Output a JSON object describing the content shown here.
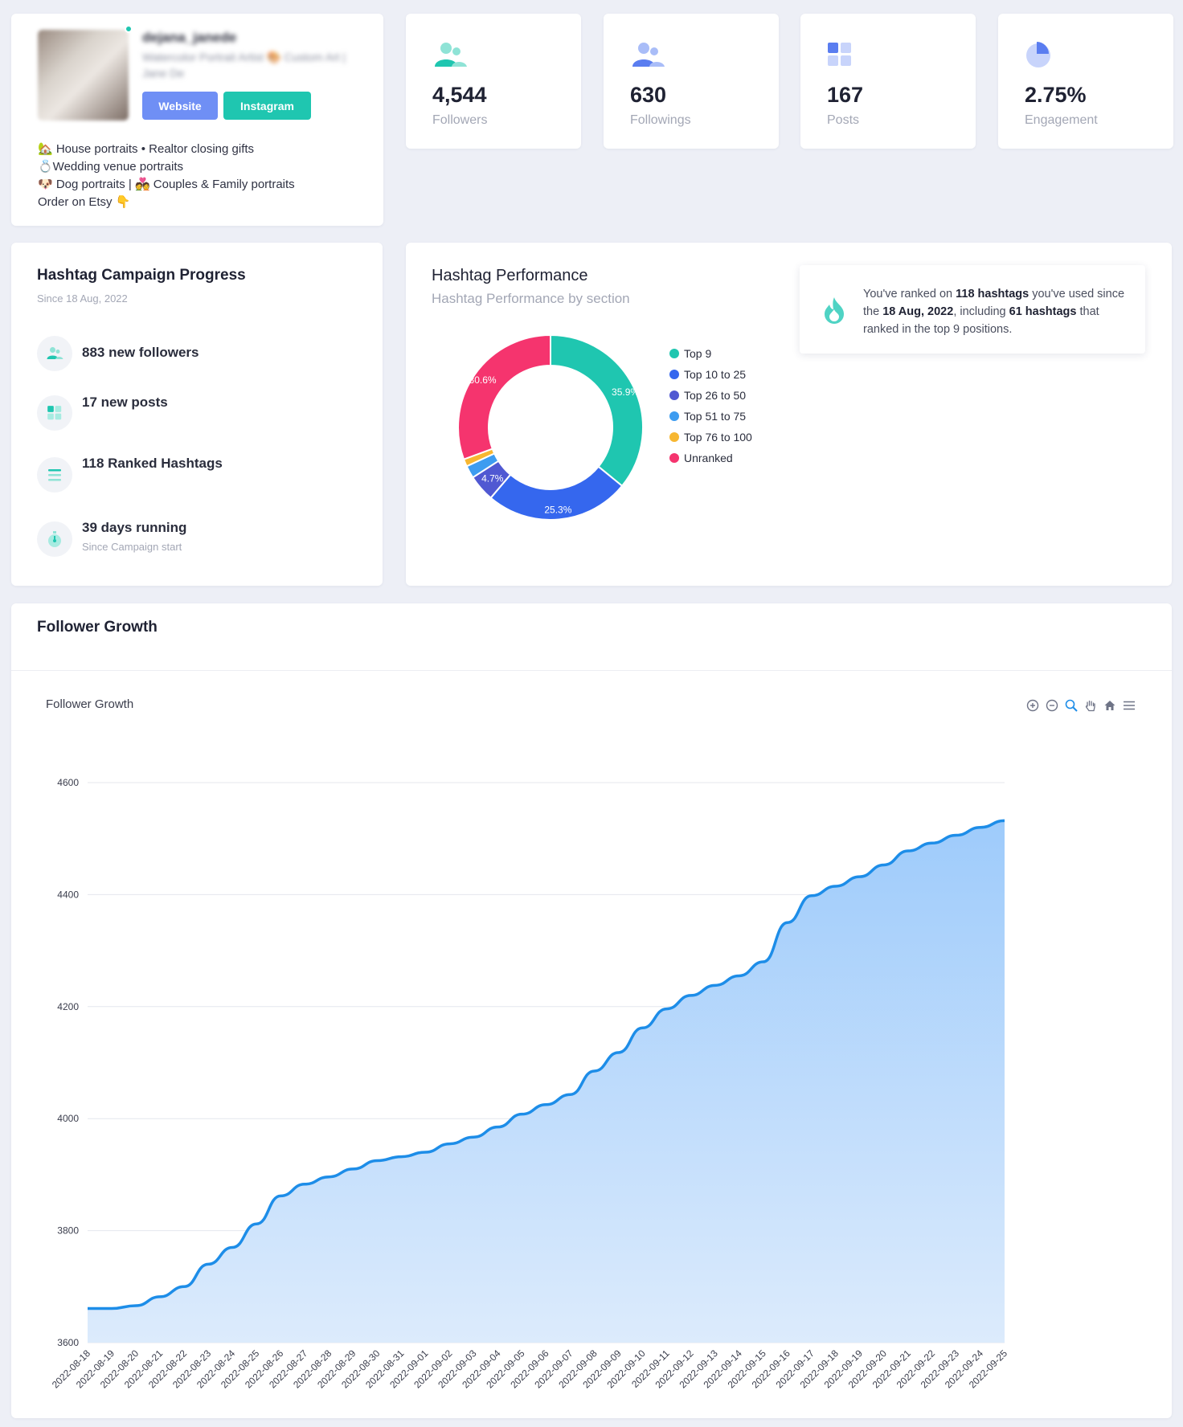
{
  "profile": {
    "username": "dejana_janede",
    "bio_blurred": "Watercolor Portrait Artist 🎨 Custom Art | Jane De",
    "website_label": "Website",
    "instagram_label": "Instagram",
    "bio_line1": "🏡 House portraits • Realtor closing gifts",
    "bio_line2": "💍Wedding venue portraits",
    "bio_line3": "🐶 Dog portraits | 💑 Couples & Family portraits",
    "bio_line4": "Order on Etsy 👇"
  },
  "stats": {
    "followers": {
      "value": "4,544",
      "label": "Followers",
      "icon": "users-icon"
    },
    "followings": {
      "value": "630",
      "label": "Followings",
      "icon": "users-icon"
    },
    "posts": {
      "value": "167",
      "label": "Posts",
      "icon": "grid-icon"
    },
    "engagement": {
      "value": "2.75%",
      "label": "Engagement",
      "icon": "pie-icon"
    }
  },
  "campaign": {
    "title": "Hashtag Campaign Progress",
    "since": "Since 18 Aug, 2022",
    "rows": [
      {
        "text": "883 new followers",
        "icon": "users-icon"
      },
      {
        "text": "17 new posts",
        "icon": "grid-icon"
      },
      {
        "text": "118 Ranked Hashtags",
        "icon": "list-icon"
      },
      {
        "text": "39 days running",
        "sub": "Since Campaign start",
        "icon": "stopwatch-icon"
      }
    ]
  },
  "performance": {
    "title": "Hashtag Performance",
    "subtitle": "Hashtag Performance by section",
    "note_prefix": "You've ranked on ",
    "note_hashtags": "118 hashtags",
    "note_mid": " you've used since the ",
    "note_date": "18 Aug, 2022",
    "note_mid2": ", including ",
    "note_top": "61 hashtags",
    "note_suffix": " that ranked in the top 9 positions."
  },
  "colors": {
    "accent_teal": "#1fc6b0",
    "accent_blue": "#6f8ff5",
    "line_blue": "#1d8de8"
  },
  "chart_data": [
    {
      "type": "pie",
      "categories": [
        "Top 9",
        "Top 10 to 25",
        "Top 26 to 50",
        "Top 51 to 75",
        "Top 76 to 100",
        "Unranked"
      ],
      "values": [
        35.9,
        25.3,
        4.7,
        2.2,
        1.3,
        30.6
      ],
      "colors": [
        "#1fc6b0",
        "#3567ee",
        "#5058d2",
        "#3d9cf0",
        "#f7b731",
        "#f5346e"
      ],
      "labels": [
        "35.9%",
        "25.3%",
        "4.7%",
        "",
        "",
        "30.6%"
      ],
      "legend": "right"
    },
    {
      "type": "area",
      "title": "Follower Growth",
      "x": [
        "2022-08-18",
        "2022-08-19",
        "2022-08-20",
        "2022-08-21",
        "2022-08-22",
        "2022-08-23",
        "2022-08-24",
        "2022-08-25",
        "2022-08-26",
        "2022-08-27",
        "2022-08-28",
        "2022-08-29",
        "2022-08-30",
        "2022-08-31",
        "2022-09-01",
        "2022-09-02",
        "2022-09-03",
        "2022-09-04",
        "2022-09-05",
        "2022-09-06",
        "2022-09-07",
        "2022-09-08",
        "2022-09-09",
        "2022-09-10",
        "2022-09-11",
        "2022-09-12",
        "2022-09-13",
        "2022-09-14",
        "2022-09-15",
        "2022-09-16",
        "2022-09-17",
        "2022-09-18",
        "2022-09-19",
        "2022-09-20",
        "2022-09-21",
        "2022-09-22",
        "2022-09-23",
        "2022-09-24",
        "2022-09-25"
      ],
      "series": [
        {
          "values": [
            3661,
            3661,
            3666,
            3682,
            3700,
            3740,
            3770,
            3812,
            3862,
            3883,
            3896,
            3910,
            3925,
            3932,
            3940,
            3955,
            3967,
            3985,
            4008,
            4025,
            4043,
            4085,
            4118,
            4162,
            4196,
            4220,
            4238,
            4255,
            4280,
            4350,
            4398,
            4415,
            4432,
            4453,
            4478,
            4492,
            4506,
            4520,
            4532
          ]
        }
      ],
      "yticks": [
        3600,
        3800,
        4000,
        4200,
        4400,
        4600
      ],
      "ylim": [
        3600,
        4600
      ],
      "grid": true
    }
  ]
}
